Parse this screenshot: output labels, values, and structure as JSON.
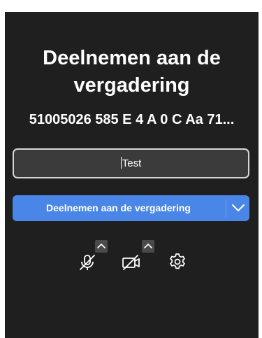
{
  "header_fragment": "",
  "title": "Deelnemen aan de vergadering",
  "meeting_id": "51005026 585 E 4 A 0 C Aa 71...",
  "name_input": {
    "value": "Test"
  },
  "join_button": {
    "label": "Deelnemen aan de vergadering"
  },
  "controls": {
    "mic_icon": "microphone-off-icon",
    "camera_icon": "camera-off-icon",
    "settings_icon": "gear-icon"
  },
  "colors": {
    "background": "#1f1f1f",
    "accent": "#4a86e8",
    "input_bg": "#3b3b3b"
  }
}
